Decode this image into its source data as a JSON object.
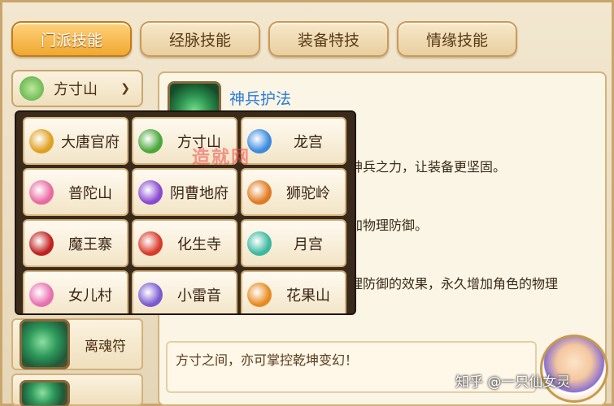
{
  "tabs": [
    {
      "label": "门派技能",
      "active": true
    },
    {
      "label": "经脉技能",
      "active": false
    },
    {
      "label": "装备特技",
      "active": false
    },
    {
      "label": "情缘技能",
      "active": false
    }
  ],
  "sect_dropdown": {
    "selected": "方寸山",
    "icon": "fangcun-sect-icon"
  },
  "left_skills": [
    {
      "name": "离魂符"
    }
  ],
  "skill_detail": {
    "title": "神兵护法",
    "lines": [
      "神兵之力，让装备更坚固。",
      "加物理防御。",
      "理防御的效果，永久增加角色的物理"
    ]
  },
  "chat_text": "方寸之间，亦可掌控乾坤变幻！",
  "watermark": "知乎 @一只仙女灵",
  "overlay_mark": "造就网",
  "sects": [
    {
      "label": "大唐官府",
      "icon": "datang-icon",
      "color": "#e0a020"
    },
    {
      "label": "方寸山",
      "icon": "fangcun-icon",
      "color": "#4aa83a"
    },
    {
      "label": "龙宫",
      "icon": "longgong-icon",
      "color": "#3a8ae0"
    },
    {
      "label": "普陀山",
      "icon": "putuo-icon",
      "color": "#e86aa0"
    },
    {
      "label": "阴曹地府",
      "icon": "yincao-icon",
      "color": "#8a4ad0"
    },
    {
      "label": "狮驼岭",
      "icon": "shituo-icon",
      "color": "#e07a20"
    },
    {
      "label": "魔王寨",
      "icon": "mowang-icon",
      "color": "#c02020"
    },
    {
      "label": "化生寺",
      "icon": "huasheng-icon",
      "color": "#d83a2a"
    },
    {
      "label": "月宫",
      "icon": "yuegong-icon",
      "color": "#3ab8a0"
    },
    {
      "label": "女儿村",
      "icon": "nuer-icon",
      "color": "#e870b0"
    },
    {
      "label": "小雷音",
      "icon": "xiaoleiyin-icon",
      "color": "#7a5ad0"
    },
    {
      "label": "花果山",
      "icon": "huaguo-icon",
      "color": "#e88a20"
    }
  ]
}
